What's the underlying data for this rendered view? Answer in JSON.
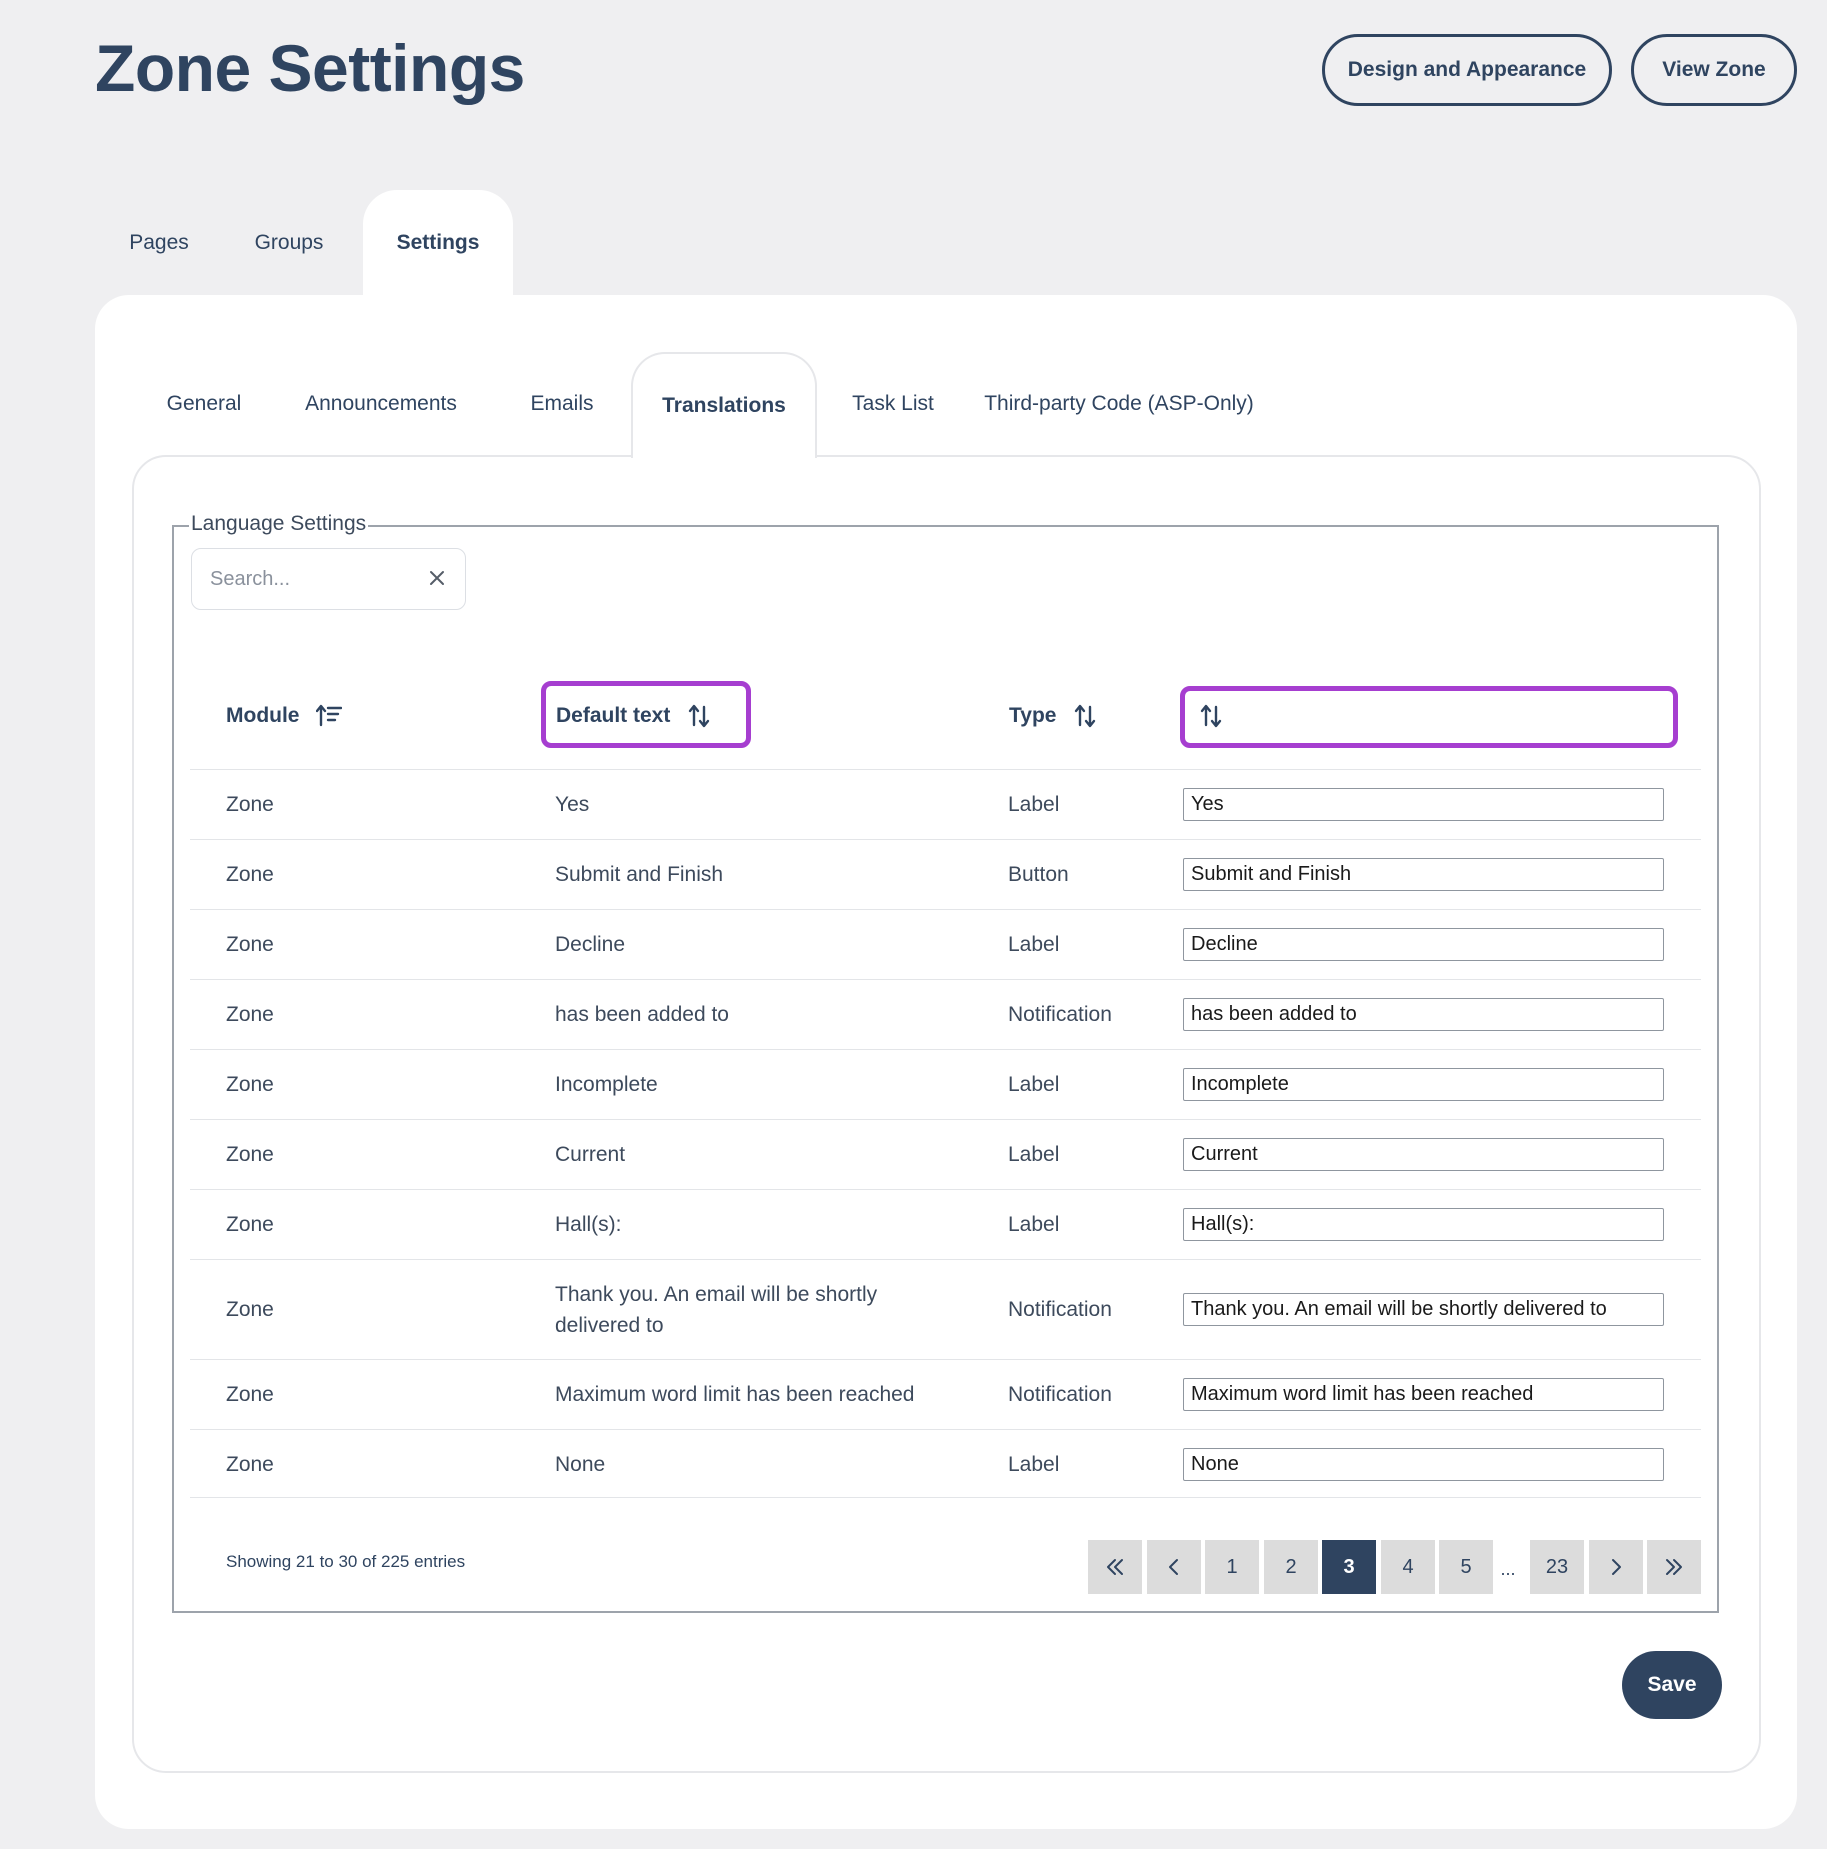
{
  "header": {
    "title": "Zone Settings",
    "design_button": "Design and Appearance",
    "view_button": "View Zone"
  },
  "top_tabs": [
    {
      "label": "Pages",
      "active": false
    },
    {
      "label": "Groups",
      "active": false
    },
    {
      "label": "Settings",
      "active": true
    }
  ],
  "sub_tabs": [
    {
      "label": "General",
      "active": false
    },
    {
      "label": "Announcements",
      "active": false
    },
    {
      "label": "Emails",
      "active": false
    },
    {
      "label": "Translations",
      "active": true
    },
    {
      "label": "Task List",
      "active": false
    },
    {
      "label": "Third-party Code (ASP-Only)",
      "active": false
    }
  ],
  "language_settings": {
    "legend": "Language Settings",
    "search_placeholder": "Search...",
    "columns": {
      "module": "Module",
      "default_text": "Default text",
      "type": "Type",
      "translation": ""
    },
    "rows": [
      {
        "module": "Zone",
        "default_text": "Yes",
        "type": "Label",
        "translation": "Yes"
      },
      {
        "module": "Zone",
        "default_text": "Submit and Finish",
        "type": "Button",
        "translation": "Submit and Finish"
      },
      {
        "module": "Zone",
        "default_text": "Decline",
        "type": "Label",
        "translation": "Decline"
      },
      {
        "module": "Zone",
        "default_text": "has been added to",
        "type": "Notification",
        "translation": "has been added to"
      },
      {
        "module": "Zone",
        "default_text": "Incomplete",
        "type": "Label",
        "translation": "Incomplete"
      },
      {
        "module": "Zone",
        "default_text": "Current",
        "type": "Label",
        "translation": "Current"
      },
      {
        "module": "Zone",
        "default_text": "Hall(s):",
        "type": "Label",
        "translation": "Hall(s):"
      },
      {
        "module": "Zone",
        "default_text": "Thank you. An email will be shortly delivered to",
        "type": "Notification",
        "translation": "Thank you. An email will be shortly delivered to"
      },
      {
        "module": "Zone",
        "default_text": "Maximum word limit has been reached",
        "type": "Notification",
        "translation": "Maximum word limit has been reached"
      },
      {
        "module": "Zone",
        "default_text": "None",
        "type": "Label",
        "translation": "None"
      }
    ],
    "info": "Showing 21 to 30 of 225 entries",
    "pagination": {
      "pages": [
        "1",
        "2",
        "3",
        "4",
        "5"
      ],
      "ellipsis": "...",
      "last": "23",
      "current": "3"
    }
  },
  "save_label": "Save",
  "colors": {
    "brand": "#2f4460",
    "highlight": "#a63ed0",
    "background": "#efeff1"
  }
}
